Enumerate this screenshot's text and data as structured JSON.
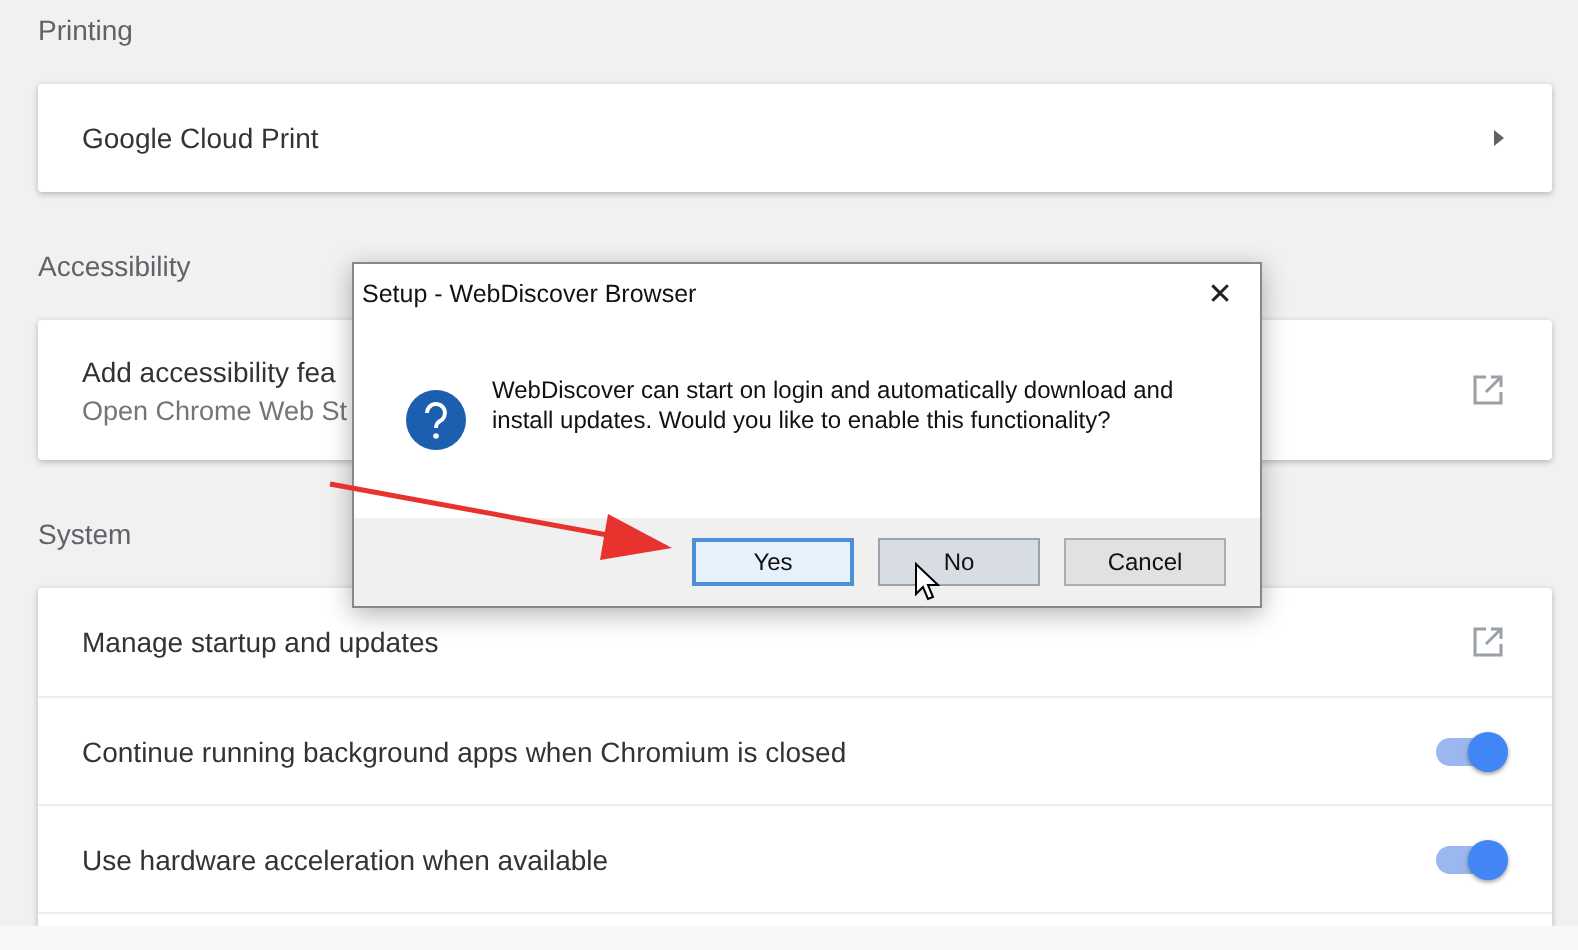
{
  "sections": [
    {
      "heading": "Printing",
      "items": [
        {
          "kind": "link",
          "title": "Google Cloud Print"
        }
      ]
    },
    {
      "heading": "Accessibility",
      "items": [
        {
          "kind": "external",
          "title": "Add accessibility fea",
          "subtitle": "Open Chrome Web St"
        }
      ]
    },
    {
      "heading": "System",
      "items": [
        {
          "kind": "external",
          "title": "Manage startup and updates"
        },
        {
          "kind": "toggle",
          "title": "Continue running background apps when Chromium is closed",
          "on": true
        },
        {
          "kind": "toggle",
          "title": "Use hardware acceleration when available",
          "on": true
        },
        {
          "kind": "blank"
        }
      ]
    }
  ],
  "dialog": {
    "title": "Setup - WebDiscover Browser",
    "close": "✕",
    "message": "WebDiscover can start on login and automatically download and install updates. Would you like to enable this functionality?",
    "buttons": [
      {
        "label": "Yes",
        "default": true,
        "hovered": false
      },
      {
        "label": "No",
        "default": false,
        "hovered": true
      },
      {
        "label": "Cancel",
        "default": false,
        "hovered": false
      }
    ]
  }
}
